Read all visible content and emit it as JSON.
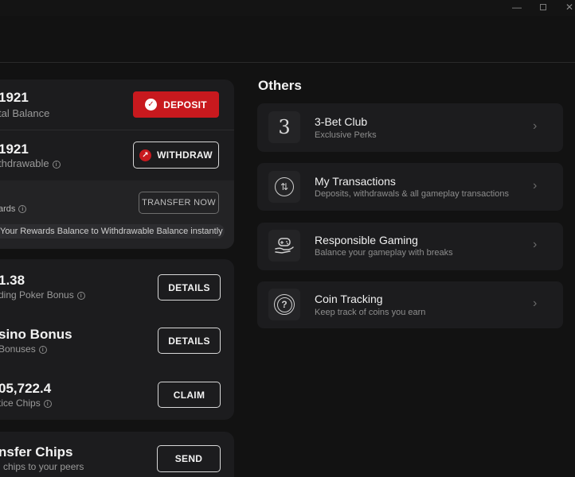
{
  "window": {
    "minimize": "—",
    "close": "✕"
  },
  "balances": {
    "total": {
      "amount": "1921",
      "label": "tal Balance",
      "button": "DEPOSIT"
    },
    "withdrawable": {
      "amount": "1921",
      "label": "thdrawable",
      "button": "WITHDRAW"
    },
    "rewards": {
      "label": "ards",
      "button": "TRANSFER NOW",
      "note": "Your Rewards Balance to Withdrawable Balance instantly"
    }
  },
  "bonuses": [
    {
      "amount": "1.38",
      "label": "ding Poker Bonus",
      "button": "DETAILS"
    },
    {
      "amount": "sino Bonus",
      "label": " Bonuses",
      "button": "DETAILS"
    },
    {
      "amount": "05,722.4",
      "label": "tice Chips",
      "button": "CLAIM"
    }
  ],
  "transfer_chips": {
    "title": "nsfer Chips",
    "label": "l chips to your peers",
    "button": "SEND"
  },
  "others": {
    "title": "Others",
    "items": [
      {
        "title": "3-Bet Club",
        "subtitle": "Exclusive Perks",
        "icon": "3-bet-logo-icon",
        "glyph": "3"
      },
      {
        "title": "My Transactions",
        "subtitle": "Deposits, withdrawals & all gameplay transactions",
        "icon": "transactions-icon",
        "glyph": "⇅"
      },
      {
        "title": "Responsible Gaming",
        "subtitle": "Balance your gameplay with breaks",
        "icon": "gamepad-hand-icon",
        "glyph": "🎮"
      },
      {
        "title": "Coin Tracking",
        "subtitle": "Keep track of coins you earn",
        "icon": "question-coin-icon",
        "glyph": "?"
      }
    ]
  },
  "colors": {
    "accent_red": "#c8191e",
    "panel": "#1c1c1e",
    "background": "#121212"
  }
}
